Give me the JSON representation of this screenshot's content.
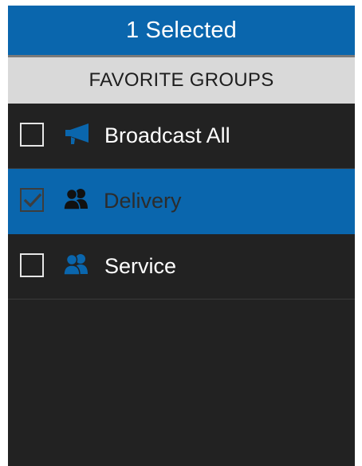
{
  "header": {
    "title": "1 Selected"
  },
  "section": {
    "title": "FAVORITE GROUPS"
  },
  "groups": [
    {
      "label": "Broadcast All",
      "icon": "megaphone-icon",
      "checked": false
    },
    {
      "label": "Delivery",
      "icon": "group-icon",
      "checked": true
    },
    {
      "label": "Service",
      "icon": "group-icon",
      "checked": false
    }
  ],
  "colors": {
    "accent": "#0a66ad",
    "background": "#222222",
    "section_header": "#d9d9d9"
  }
}
